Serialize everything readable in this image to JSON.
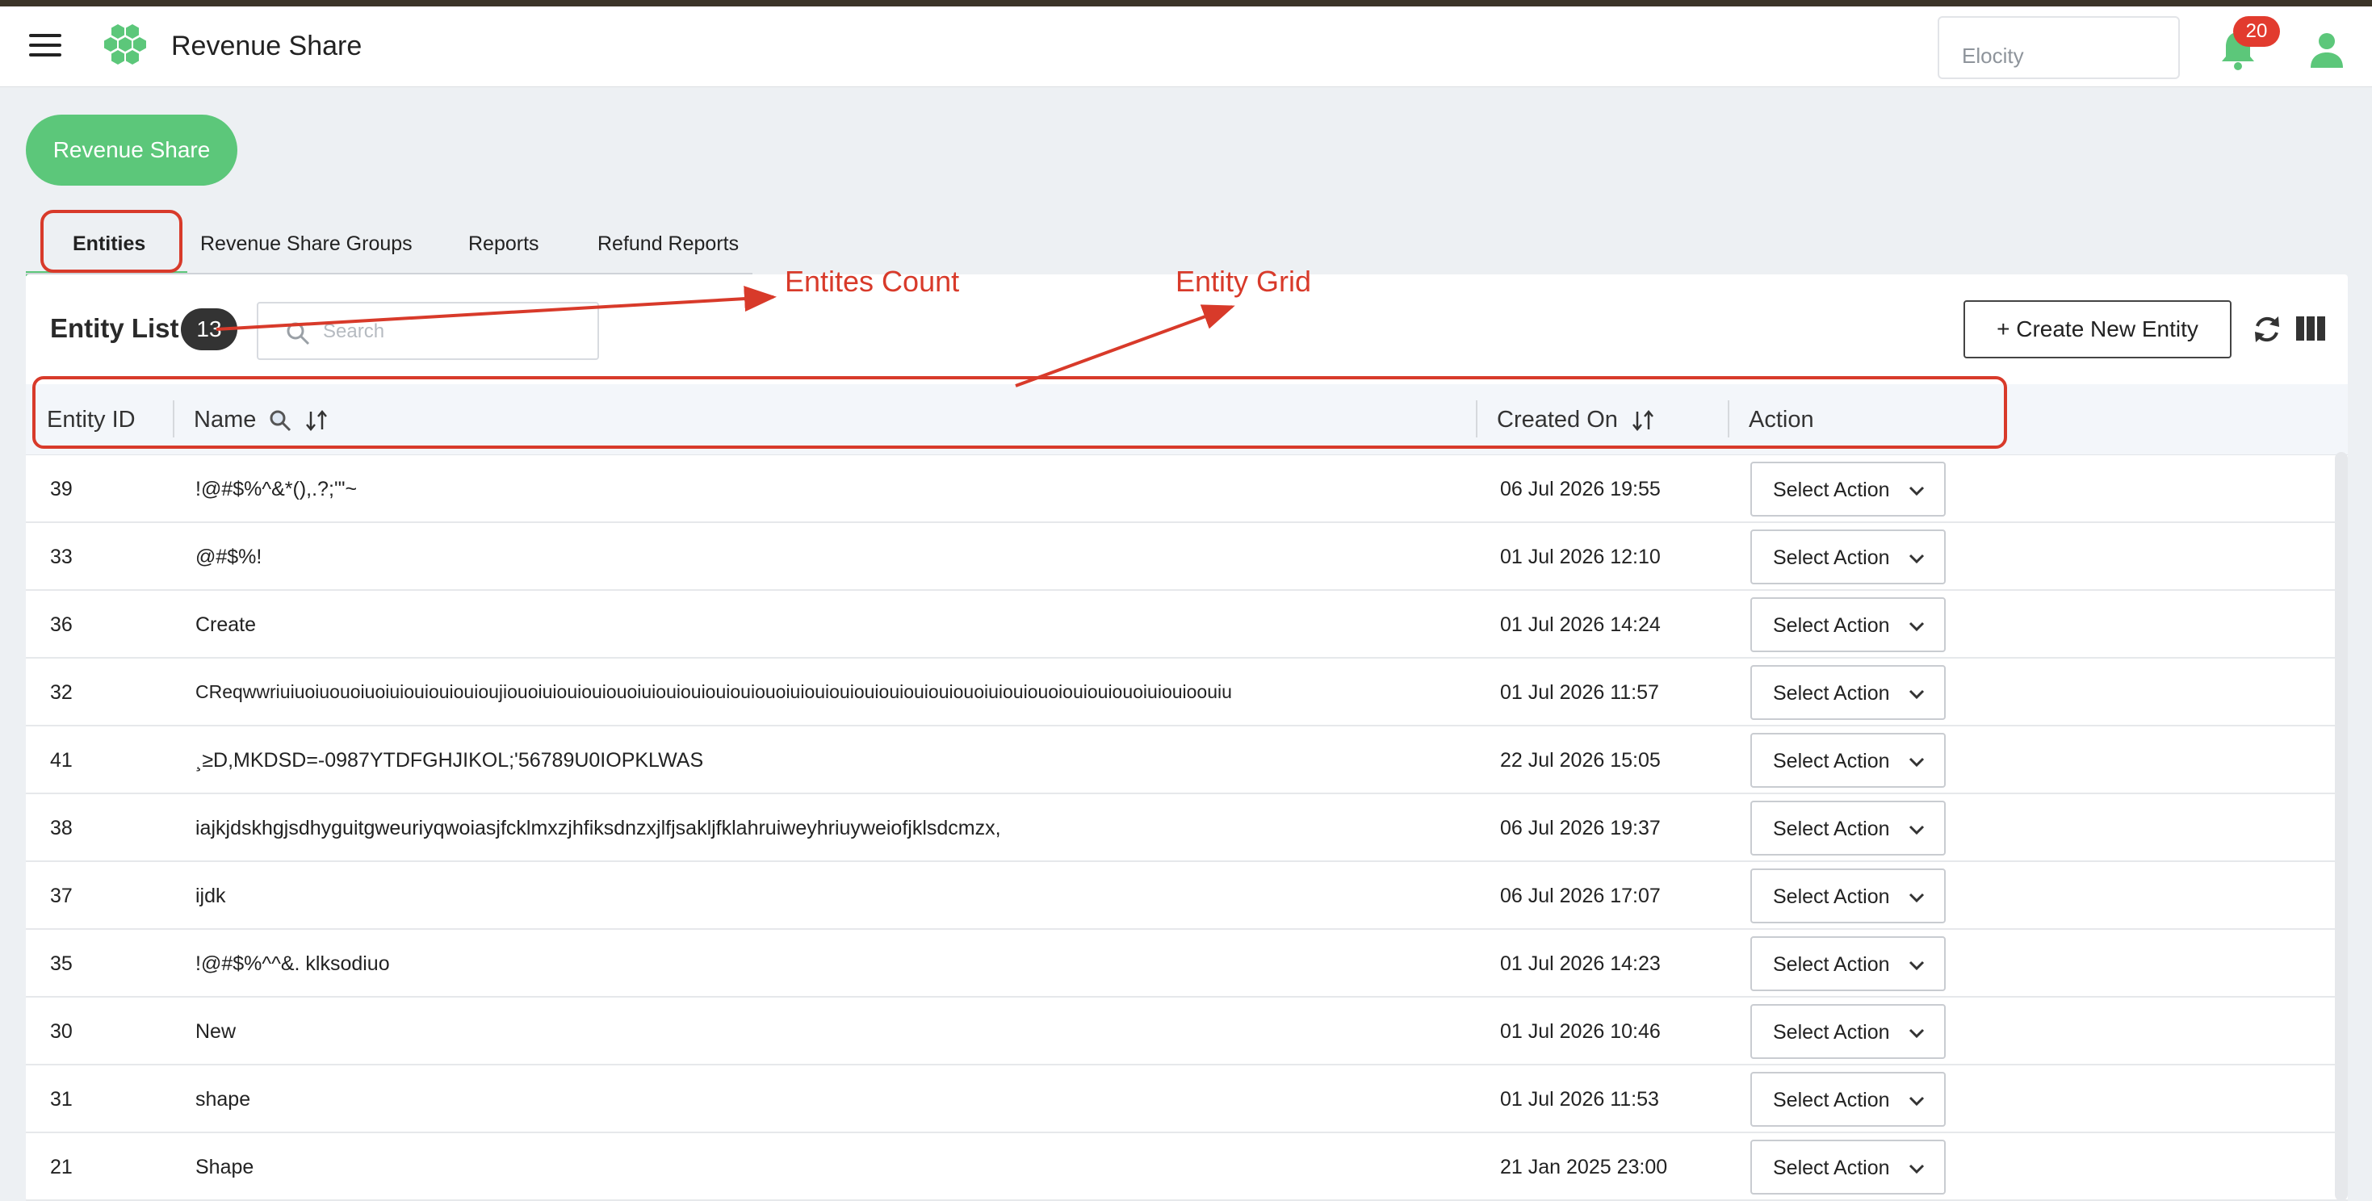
{
  "header": {
    "title": "Revenue Share",
    "org_selector": "Elocity",
    "notifications_count": "20",
    "icons": [
      "menu-icon",
      "logo-icon",
      "bell-icon",
      "user-icon"
    ]
  },
  "page_button": "Revenue Share",
  "tabs": [
    {
      "label": "Entities",
      "active": true
    },
    {
      "label": "Revenue Share Groups",
      "active": false
    },
    {
      "label": "Reports",
      "active": false
    },
    {
      "label": "Refund Reports",
      "active": false
    }
  ],
  "list": {
    "title": "Entity List",
    "count": "13",
    "search_placeholder": "Search",
    "create_button": "+ Create New Entity"
  },
  "table": {
    "columns": [
      "Entity ID",
      "Name",
      "Created On",
      "Action"
    ],
    "action_label": "Select Action",
    "rows": [
      {
        "id": "39",
        "name": "!@#$%^&*(),.?;'\"~",
        "created": "06 Jul 2026 19:55"
      },
      {
        "id": "33",
        "name": "@#$%!",
        "created": "01 Jul 2026 12:10"
      },
      {
        "id": "36",
        "name": "Create",
        "created": "01 Jul 2026 14:24"
      },
      {
        "id": "32",
        "name": "CReqwwriuiuoiuouoiuoiuiouiouiouioujiouoiuiouiouiouoiuiouiouiouiouiouoiuiouiouiouiouiouiouiouoiuiouiouoiouiouiouoiuiouioouiu",
        "created": "01 Jul 2026 11:57"
      },
      {
        "id": "41",
        "name": "¸≥D,MKDSD=-0987YTDFGHJIKOL;'56789U0IOPKLWAS",
        "created": "22 Jul 2026 15:05"
      },
      {
        "id": "38",
        "name": "iajkjdskhgjsdhyguitgweuriyqwoiasjfcklmxzjhfiksdnzxjlfjsakljfklahruiweyhriuyweiofjklsdcmzx,",
        "created": "06 Jul 2026 19:37"
      },
      {
        "id": "37",
        "name": "ijdk",
        "created": "06 Jul 2026 17:07"
      },
      {
        "id": "35",
        "name": "!@#$%^^&. klksodiuo",
        "created": "01 Jul 2026 14:23"
      },
      {
        "id": "30",
        "name": "New",
        "created": "01 Jul 2026 10:46"
      },
      {
        "id": "31",
        "name": "shape",
        "created": "01 Jul 2026 11:53"
      },
      {
        "id": "21",
        "name": "Shape",
        "created": "21 Jan 2025 23:00"
      }
    ]
  },
  "annotations": {
    "count_label": "Entites Count",
    "grid_label": "Entity Grid",
    "color": "#d83a2a"
  },
  "colors": {
    "brand_green": "#5cc77a",
    "badge_red": "#e23b2e"
  }
}
